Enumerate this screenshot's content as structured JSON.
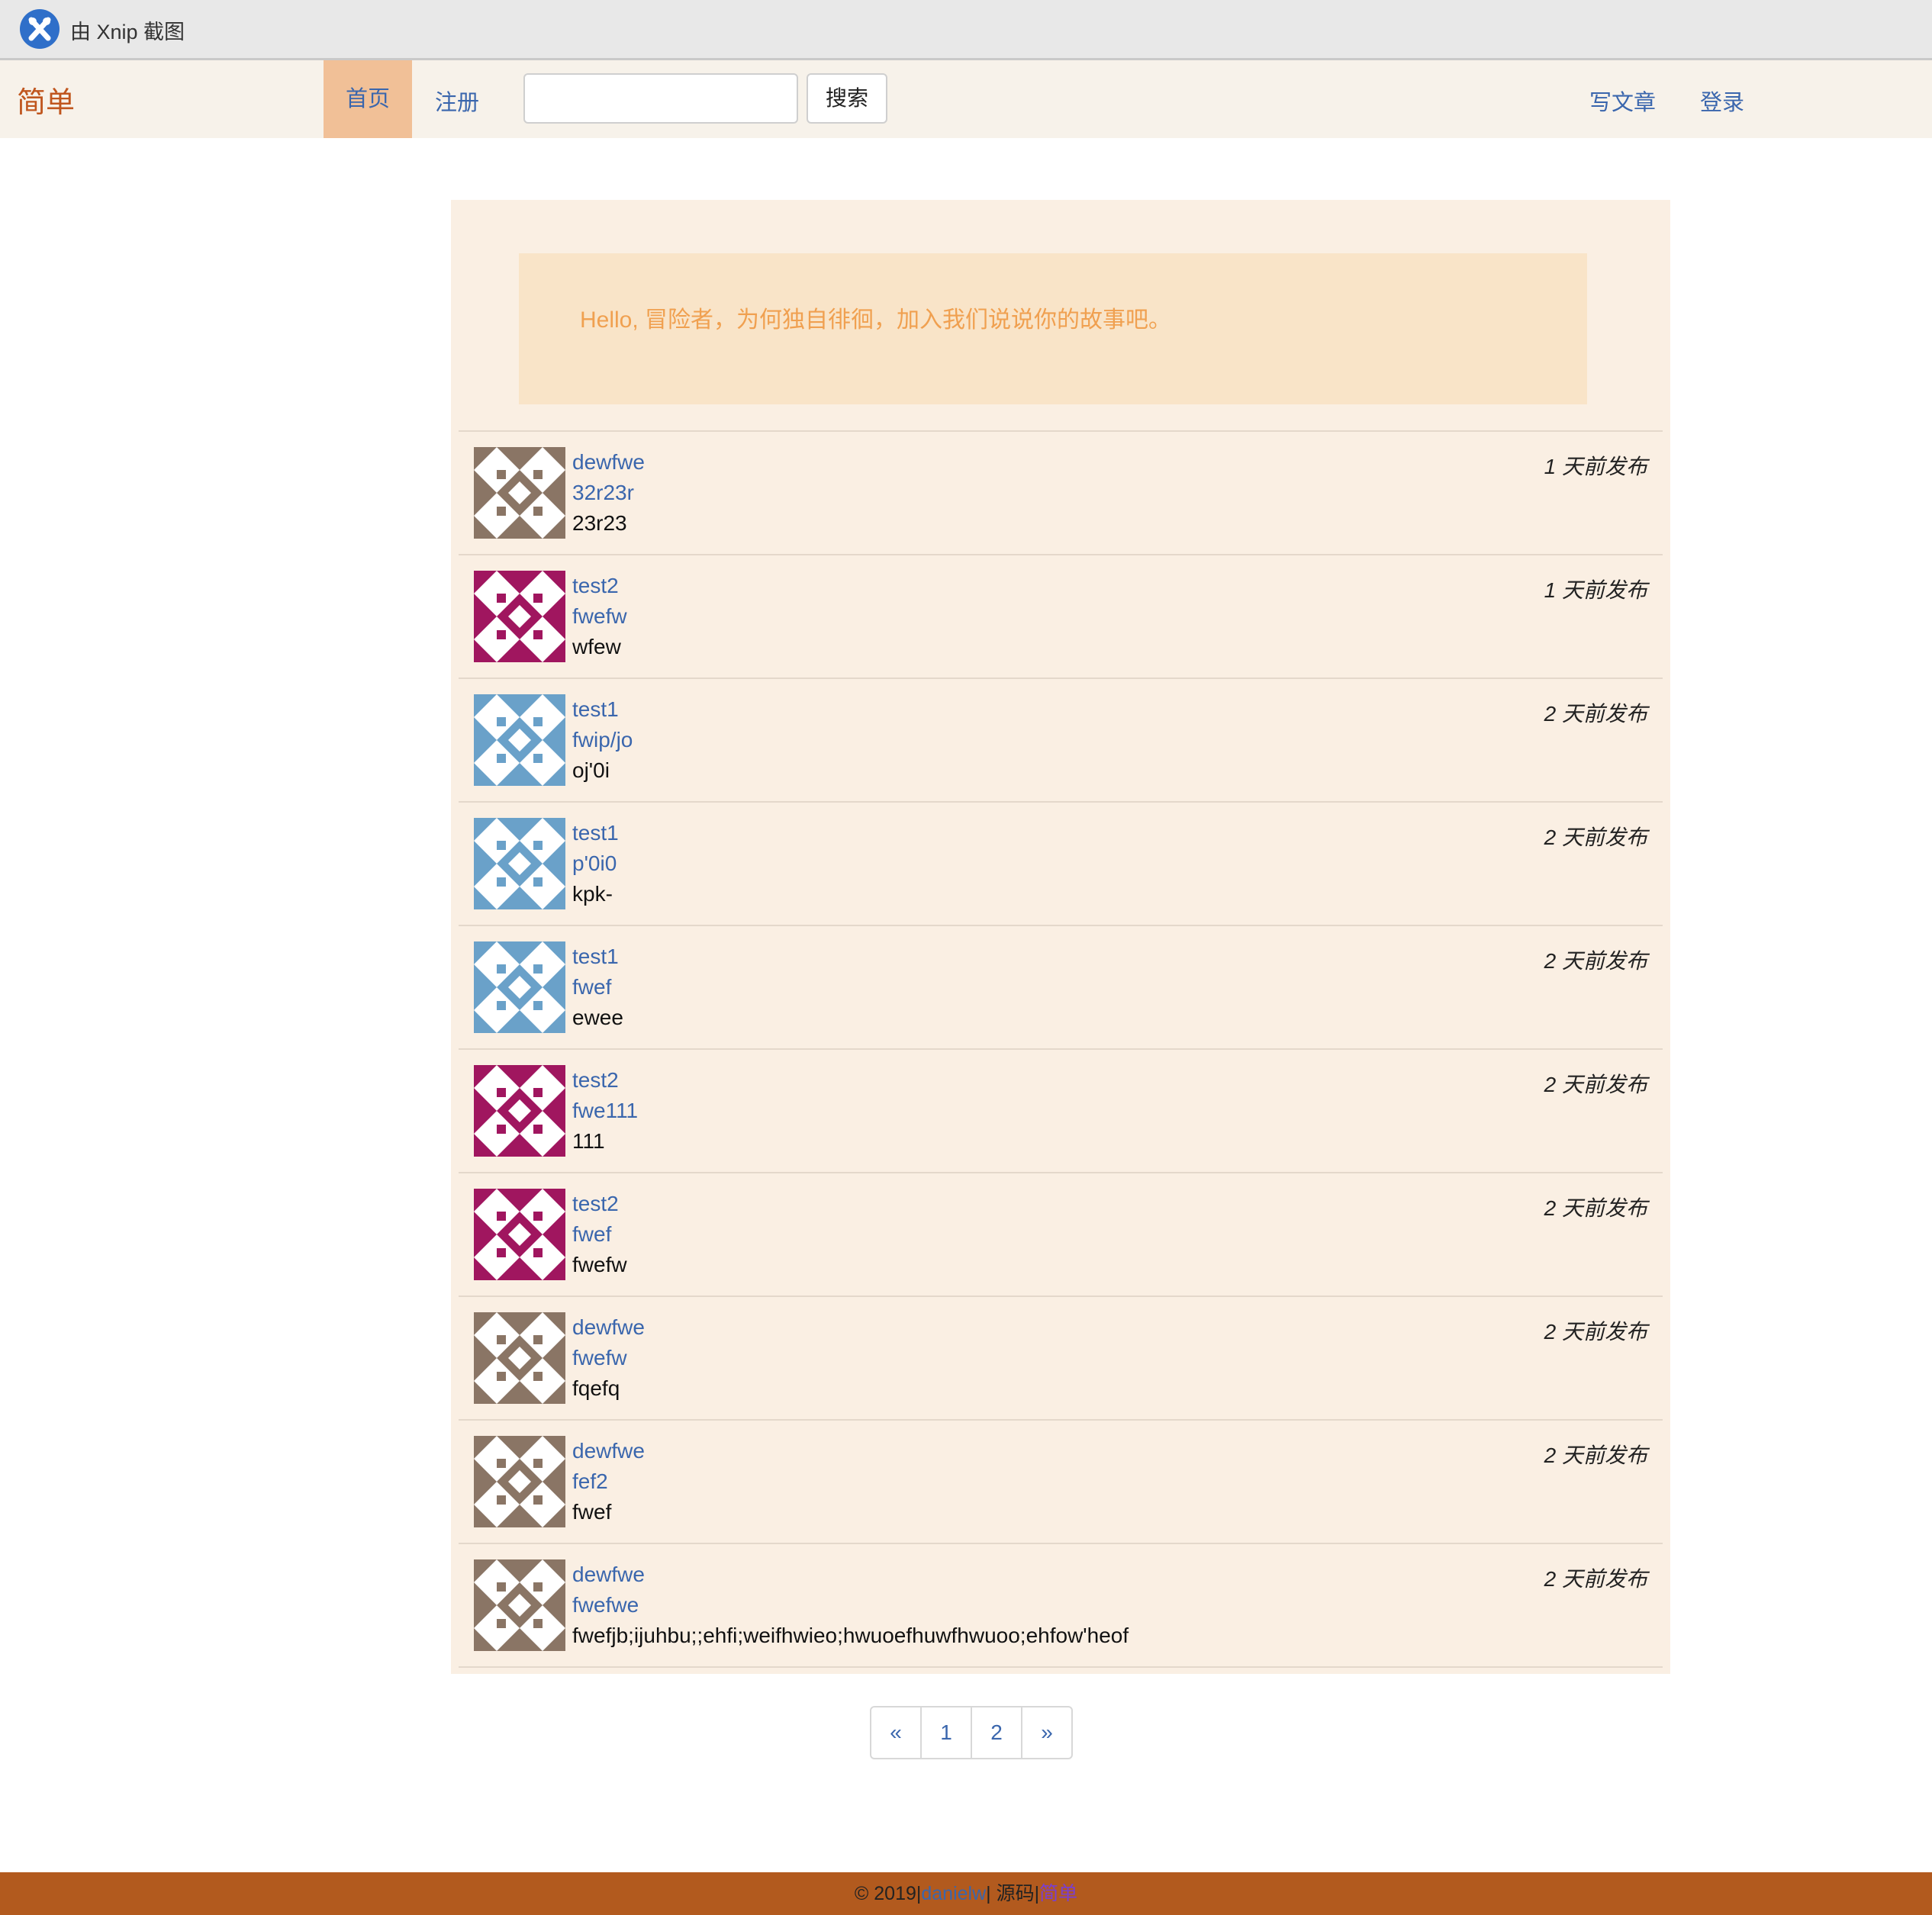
{
  "capture_bar": {
    "title": "由 Xnip 截图",
    "icon": "xnip-icon"
  },
  "nav": {
    "brand": "简单",
    "home": "首页",
    "register": "注册",
    "search_placeholder": "",
    "search_button": "搜索",
    "write": "写文章",
    "login": "登录"
  },
  "jumbotron": {
    "text": "Hello, 冒险者，为何独自徘徊，加入我们说说你的故事吧。"
  },
  "posts": [
    {
      "user": "dewfwe",
      "title": "32r23r",
      "body": "23r23",
      "time": "1 天前发布",
      "avatar": "brown-identicon"
    },
    {
      "user": "test2",
      "title": "fwefw",
      "body": "wfew",
      "time": "1 天前发布",
      "avatar": "magenta-identicon"
    },
    {
      "user": "test1",
      "title": "fwip/jo",
      "body": "oj'0i",
      "time": "2 天前发布",
      "avatar": "blue-identicon"
    },
    {
      "user": "test1",
      "title": "p'0i0",
      "body": "kpk-",
      "time": "2 天前发布",
      "avatar": "blue-identicon"
    },
    {
      "user": "test1",
      "title": "fwef",
      "body": "ewee",
      "time": "2 天前发布",
      "avatar": "blue-identicon"
    },
    {
      "user": "test2",
      "title": "fwe111",
      "body": "111",
      "time": "2 天前发布",
      "avatar": "magenta-identicon"
    },
    {
      "user": "test2",
      "title": "fwef",
      "body": "fwefw",
      "time": "2 天前发布",
      "avatar": "magenta-identicon"
    },
    {
      "user": "dewfwe",
      "title": "fwefw",
      "body": "fqefq",
      "time": "2 天前发布",
      "avatar": "brown-identicon"
    },
    {
      "user": "dewfwe",
      "title": "fef2",
      "body": "fwef",
      "time": "2 天前发布",
      "avatar": "brown-identicon"
    },
    {
      "user": "dewfwe",
      "title": "fwefwe",
      "body": "fwefjb;ijuhbu;;ehfi;weifhwieo;hwuoefhuwfhwuoo;ehfow'heof",
      "time": "2 天前发布",
      "avatar": "brown-identicon"
    }
  ],
  "pagination": {
    "prev": "«",
    "pages": [
      "1",
      "2"
    ],
    "next": "»"
  },
  "footer": {
    "copyright": "© 2019|",
    "author": "danielw",
    "source": "| 源码|",
    "project": "简单"
  },
  "colors": {
    "brown": "#8a7565",
    "magenta": "#a0165f",
    "blue": "#6aa1c9",
    "link": "#3a66ad",
    "footer_bg": "#b25a1e"
  }
}
